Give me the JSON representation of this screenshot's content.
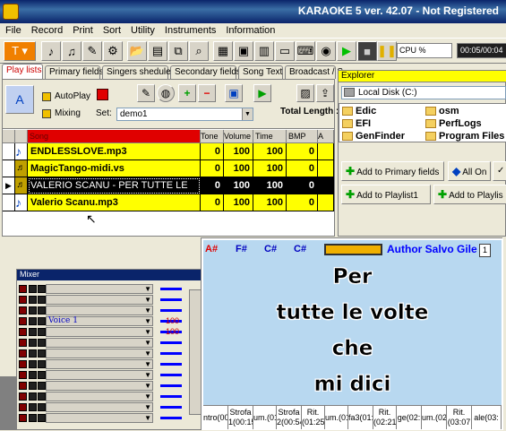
{
  "window": {
    "title": "KARAOKE 5    ver. 42.07 - Not Registered"
  },
  "menu": [
    "File",
    "Record",
    "Print",
    "Sort",
    "Utility",
    "Instruments",
    "Information"
  ],
  "toolbar": {
    "cpu_label": "CPU %",
    "time": "00:05/00:04"
  },
  "tabs": [
    "Play lists",
    "Primary fields",
    "Singers shedule",
    "Secondary fields",
    "Song Text",
    "Broadcast / S"
  ],
  "playlist": {
    "autoplay_label": "AutoPlay",
    "mixing_label": "Mixing",
    "set_label": "Set:",
    "set_value": "demo1",
    "total_length_label": "Total Length :",
    "columns": [
      "Song",
      "Tone",
      "Volume",
      "Time",
      "BMP",
      "A"
    ],
    "rows": [
      {
        "song": "ENDLESSLOVE.mp3",
        "tone": "0",
        "volume": "100",
        "time": "100",
        "bmp": "0"
      },
      {
        "song": "MagicTango-midi.vs",
        "tone": "0",
        "volume": "100",
        "time": "100",
        "bmp": "0"
      },
      {
        "song": "VALERIO SCANU - PER TUTTE LE",
        "tone": "0",
        "volume": "100",
        "time": "100",
        "bmp": "0"
      },
      {
        "song": "Valerio Scanu.mp3",
        "tone": "0",
        "volume": "100",
        "time": "100",
        "bmp": "0"
      }
    ]
  },
  "explorer": {
    "title": "Explorer",
    "drive": "Local Disk (C:)",
    "folders": [
      "Edic",
      "osm",
      "EFI",
      "PerfLogs",
      "GenFinder",
      "Program Files"
    ],
    "buttons": [
      "Add to Primary fields",
      "All On",
      "Add to Playlist1",
      "Add to Playlis"
    ]
  },
  "mixer": {
    "title": "Mixer",
    "voice_label": "Voice 1",
    "values": [
      "100",
      "100"
    ]
  },
  "lyrics": {
    "chords": [
      "A#",
      "F#",
      "C#",
      "C#"
    ],
    "author": "Author Salvo Gile",
    "spin_value": "1",
    "lines": [
      "Per",
      "tutte le volte",
      "che",
      "mi dici"
    ],
    "sections": [
      "ntro(00",
      "Strofa\n1(00:15",
      "um.(01:",
      "Strofa\n2(00:54",
      "Rit.\n(01:25",
      "um.(01:",
      "fa3(01:",
      "Rit.\n(02:21",
      "ge(02:",
      "um.(02:",
      "Rit.\n(03:07",
      "ale(03:"
    ]
  },
  "colors": {
    "accent": "#0a246a",
    "highlight": "#ffff00",
    "lyrics_bg": "#b8d8f0"
  }
}
